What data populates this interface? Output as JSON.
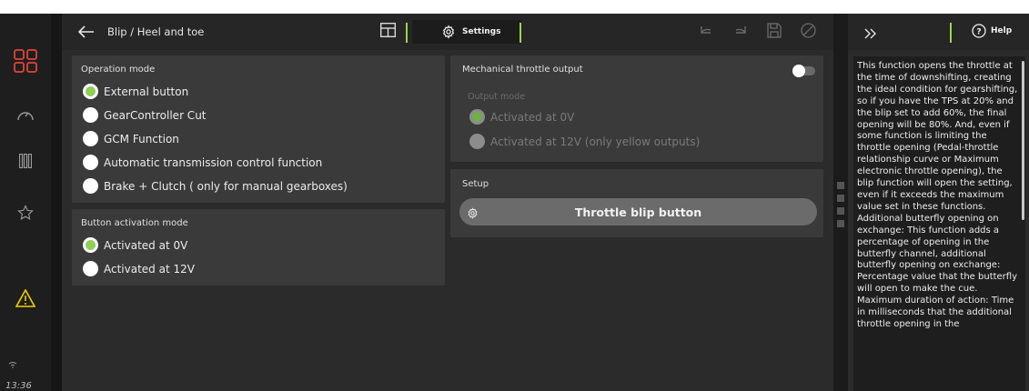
{
  "sidebar": {
    "time": "13:36",
    "icons": [
      "grid-icon",
      "gauge-icon",
      "columns-icon",
      "star-icon",
      "warning-icon",
      "wifi-icon"
    ]
  },
  "header": {
    "title": "Blip / Heel and toe",
    "settings_label": "Settings"
  },
  "operation_mode": {
    "title": "Operation mode",
    "options": [
      {
        "label": "External button",
        "selected": true
      },
      {
        "label": "GearController Cut",
        "selected": false
      },
      {
        "label": "GCM Function",
        "selected": false
      },
      {
        "label": "Automatic transmission control function",
        "selected": false
      },
      {
        "label": "Brake + Clutch ( only for manual gearboxes)",
        "selected": false
      }
    ]
  },
  "button_activation": {
    "title": "Button activation mode",
    "options": [
      {
        "label": "Activated at 0V",
        "selected": true
      },
      {
        "label": "Activated at 12V",
        "selected": false
      }
    ]
  },
  "mechanical_throttle": {
    "title": "Mechanical throttle output",
    "toggle_on": false,
    "output_mode_label": "Output mode",
    "options": [
      {
        "label": "Activated at 0V",
        "selected": true
      },
      {
        "label": "Activated at 12V (only yellow outputs)",
        "selected": false
      }
    ]
  },
  "setup": {
    "title": "Setup",
    "button_label": "Throttle blip button"
  },
  "help": {
    "label": "Help",
    "text": "This function opens the throttle at the time of downshifting, creating the ideal condition for gearshifting, so if you have the TPS at 20% and the blip set to add 60%, the final opening will be 80%. And, even if some function is limiting the throttle opening (Pedal-throttle relationship curve or Maximum electronic throttle opening), the blip function will open the setting, even if it exceeds the maximum value set in these functions.\nAdditional butterfly opening on exchange: This function adds a percentage of opening in the butterfly channel, additional butterfly opening on exchange: Percentage value that the butterfly will open to make the cue.\nMaximum duration of action: Time in milliseconds that the additional throttle opening in the"
  },
  "colors": {
    "accent_green": "#9bd64a",
    "warning_yellow": "#f0d000",
    "logo_red": "#e0443a"
  }
}
